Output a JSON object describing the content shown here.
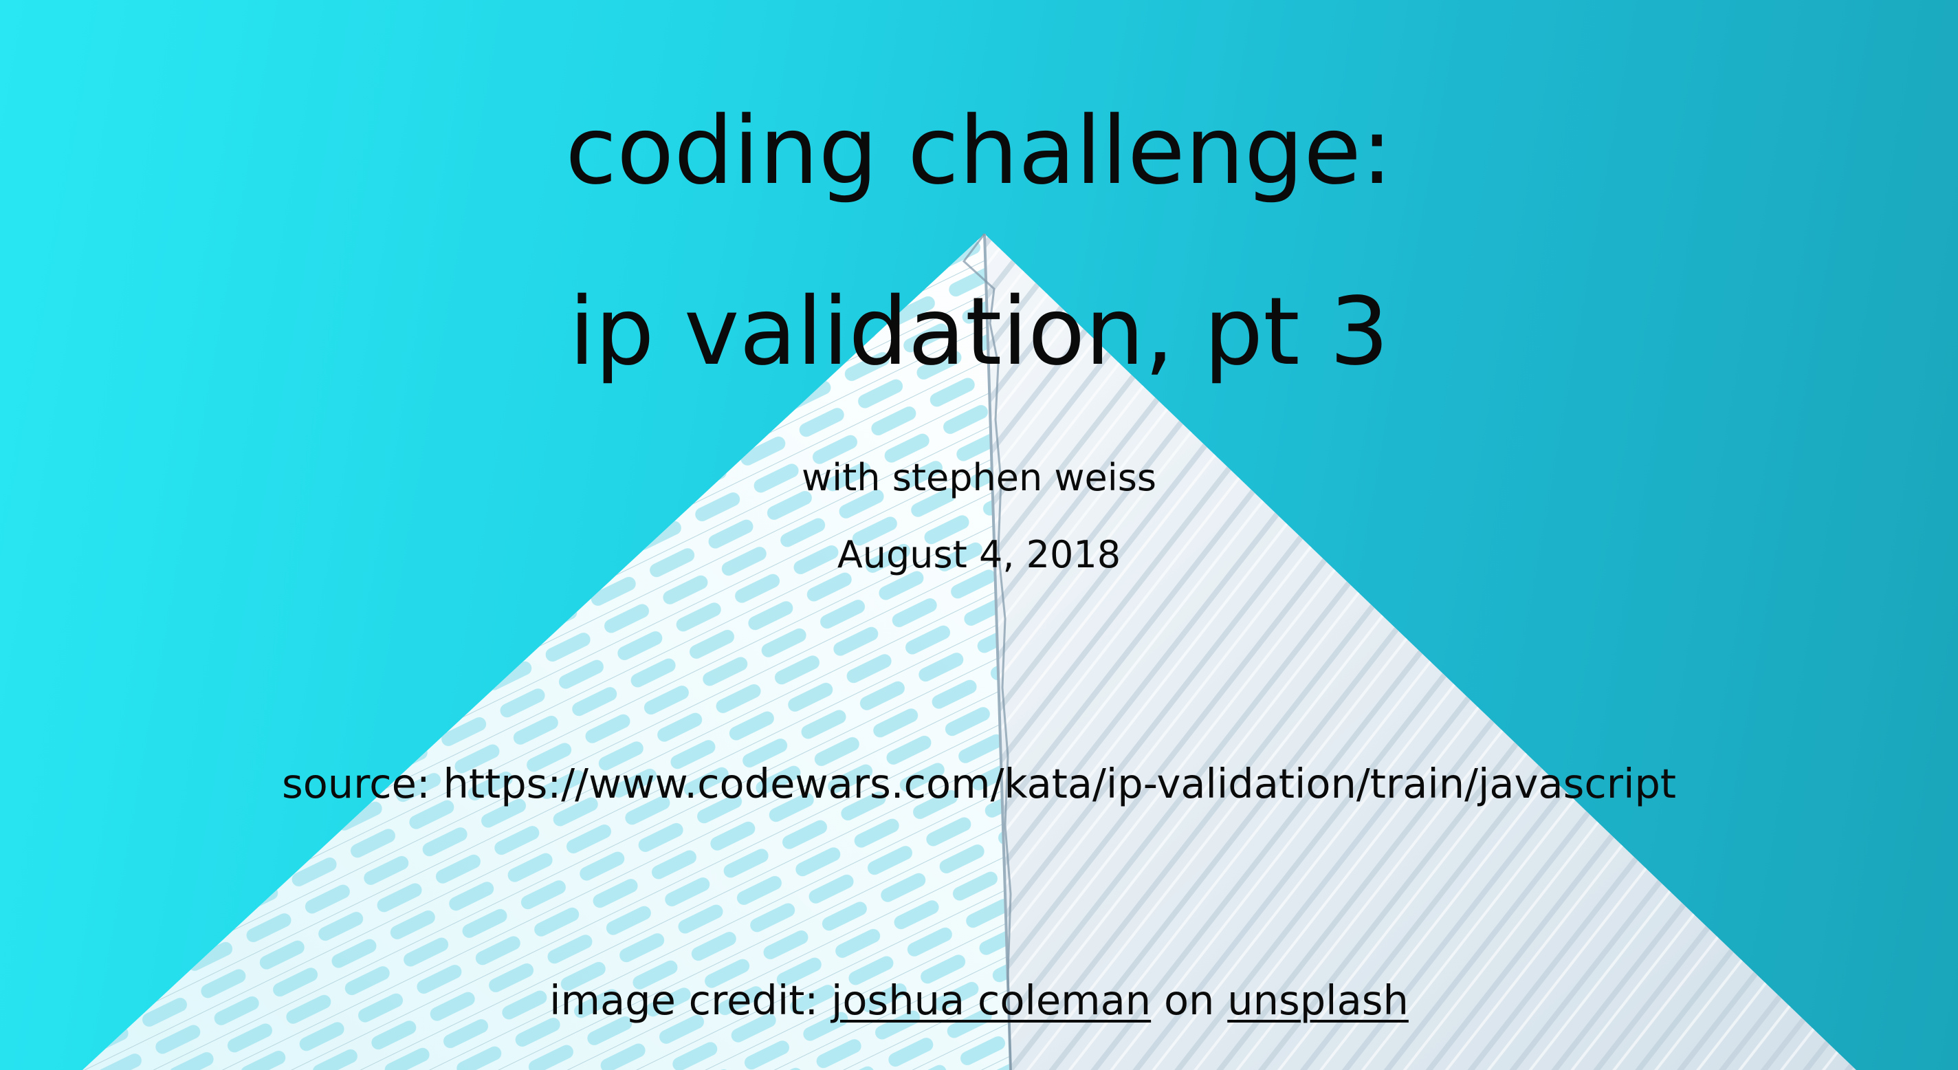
{
  "slide": {
    "title_line_1": "coding challenge:",
    "title_line_2": "ip validation, pt 3",
    "author": "with stephen weiss",
    "date": "August 4, 2018",
    "source_label": "source:",
    "source_url": "https://www.codewars.com/kata/ip-validation/train/javascript",
    "credit_prefix": "image credit:",
    "credit_photographer": "joshua coleman",
    "credit_on": "on",
    "credit_platform": "unsplash"
  },
  "colors": {
    "background_light": "#29e8f3",
    "background_dark": "#1aa5ba",
    "text": "#0a0a0a",
    "building_white": "#f1fbfd",
    "building_shadow": "#c9d9e2"
  }
}
